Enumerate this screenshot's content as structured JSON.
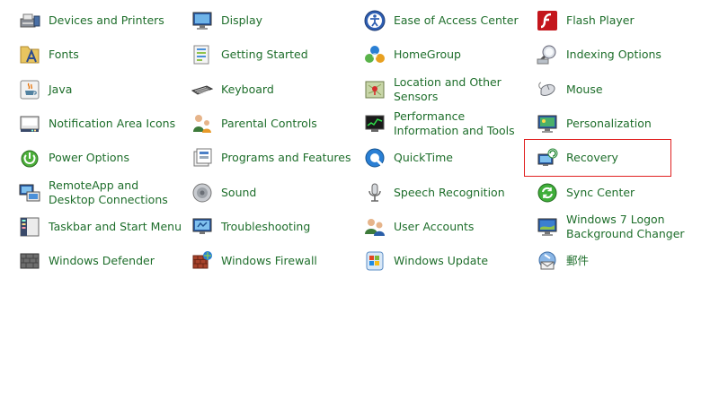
{
  "items": [
    {
      "label": "Devices and Printers",
      "icon": "devices-printers-icon"
    },
    {
      "label": "Display",
      "icon": "display-icon"
    },
    {
      "label": "Ease of Access Center",
      "icon": "ease-of-access-icon"
    },
    {
      "label": "Flash Player",
      "icon": "flash-player-icon"
    },
    {
      "label": "Fonts",
      "icon": "fonts-icon"
    },
    {
      "label": "Getting Started",
      "icon": "getting-started-icon"
    },
    {
      "label": "HomeGroup",
      "icon": "homegroup-icon"
    },
    {
      "label": "Indexing Options",
      "icon": "indexing-options-icon"
    },
    {
      "label": "Java",
      "icon": "java-icon"
    },
    {
      "label": "Keyboard",
      "icon": "keyboard-icon"
    },
    {
      "label": "Location and Other Sensors",
      "icon": "location-sensors-icon"
    },
    {
      "label": "Mouse",
      "icon": "mouse-icon"
    },
    {
      "label": "Notification Area Icons",
      "icon": "notification-area-icon"
    },
    {
      "label": "Parental Controls",
      "icon": "parental-controls-icon"
    },
    {
      "label": "Performance Information and Tools",
      "icon": "performance-icon"
    },
    {
      "label": "Personalization",
      "icon": "personalization-icon"
    },
    {
      "label": "Power Options",
      "icon": "power-options-icon"
    },
    {
      "label": "Programs and Features",
      "icon": "programs-features-icon"
    },
    {
      "label": "QuickTime",
      "icon": "quicktime-icon"
    },
    {
      "label": "Recovery",
      "icon": "recovery-icon"
    },
    {
      "label": "RemoteApp and Desktop Connections",
      "icon": "remoteapp-icon"
    },
    {
      "label": "Sound",
      "icon": "sound-icon"
    },
    {
      "label": "Speech Recognition",
      "icon": "speech-recognition-icon"
    },
    {
      "label": "Sync Center",
      "icon": "sync-center-icon"
    },
    {
      "label": "Taskbar and Start Menu",
      "icon": "taskbar-start-menu-icon"
    },
    {
      "label": "Troubleshooting",
      "icon": "troubleshooting-icon"
    },
    {
      "label": "User Accounts",
      "icon": "user-accounts-icon"
    },
    {
      "label": "Windows 7 Logon Background Changer",
      "icon": "logon-background-icon"
    },
    {
      "label": "Windows Defender",
      "icon": "windows-defender-icon"
    },
    {
      "label": "Windows Firewall",
      "icon": "windows-firewall-icon"
    },
    {
      "label": "Windows Update",
      "icon": "windows-update-icon"
    },
    {
      "label": "郵件",
      "icon": "mail-icon"
    }
  ],
  "colors": {
    "link": "#1e6e2b",
    "highlight": "#e02020"
  }
}
